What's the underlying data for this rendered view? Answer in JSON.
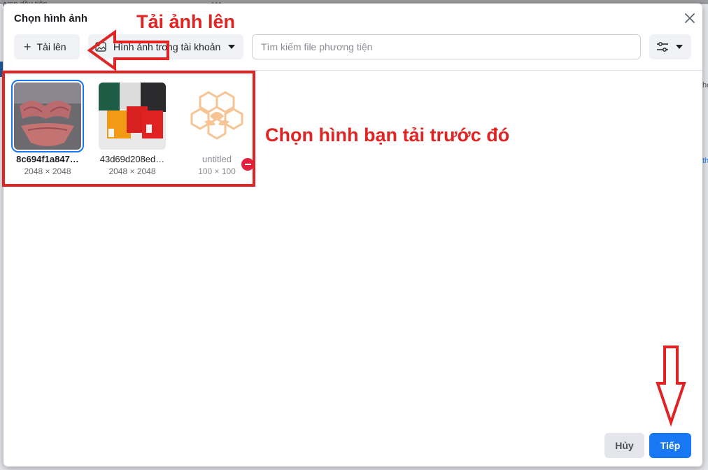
{
  "background": {
    "text_top": "amp dầu tiên",
    "dots": "•••",
    "right_text_1": "ho",
    "right_text_2": "",
    "right_text_3": "th"
  },
  "modal": {
    "title": "Chọn hình ảnh",
    "upload_label": "Tải lên",
    "source_label": "Hình ảnh trong tài khoản",
    "search_placeholder": "Tìm kiếm file phương tiện",
    "cancel_label": "Hủy",
    "next_label": "Tiếp"
  },
  "images": [
    {
      "name": "8c694f1a847…",
      "size": "2048 × 2048",
      "selected": true
    },
    {
      "name": "43d69d208ed…",
      "size": "2048 × 2048",
      "selected": false
    },
    {
      "name": "untitled",
      "size": "100 × 100",
      "selected": false
    }
  ],
  "annotations": {
    "upload": "Tải ảnh lên",
    "choose": "Chọn hình bạn tải trước đó",
    "color": "#e02424"
  },
  "colors": {
    "primary": "#1877f2",
    "danger": "#e41e3f"
  }
}
